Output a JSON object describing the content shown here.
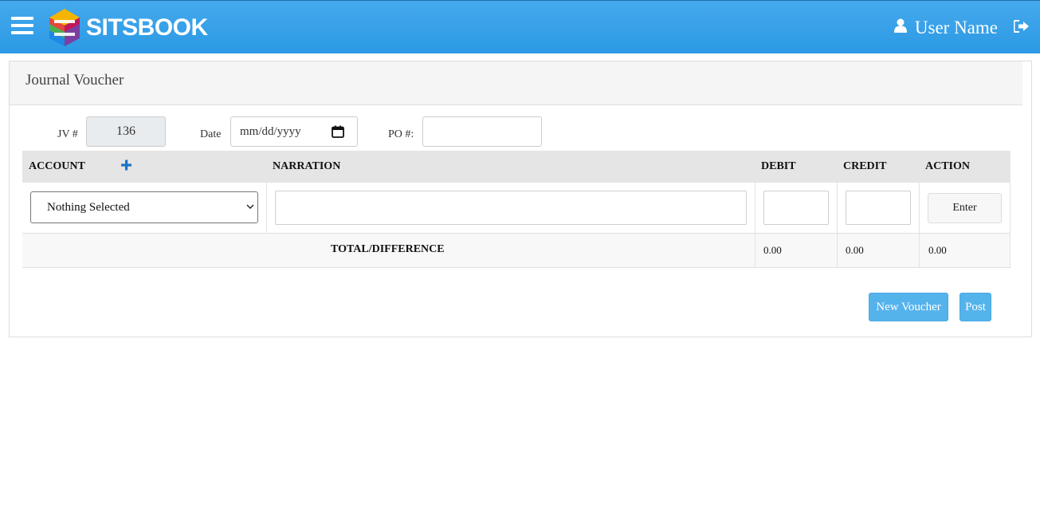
{
  "header": {
    "brand": "SITSBOOK",
    "user_name": "User Name"
  },
  "page": {
    "title": "Journal Voucher"
  },
  "form": {
    "jv_label": "JV #",
    "jv_value": "136",
    "date_label": "Date",
    "date_placeholder": "mm/dd/yyyy",
    "po_label": "PO #:",
    "po_value": ""
  },
  "table": {
    "columns": {
      "account": "ACCOUNT",
      "narration": "NARRATION",
      "debit": "DEBIT",
      "credit": "CREDIT",
      "action": "ACTION"
    },
    "entry_row": {
      "account_selected": "Nothing Selected",
      "narration": "",
      "debit": "",
      "credit": "",
      "enter_label": "Enter"
    },
    "totals": {
      "label": "TOTAL/DIFFERENCE",
      "debit": "0.00",
      "credit": "0.00",
      "difference": "0.00"
    }
  },
  "actions": {
    "new_voucher_label": "New Voucher",
    "post_label": "Post"
  },
  "colors": {
    "navbar": "#2b99e4",
    "button_primary": "#55b3ec",
    "add_icon": "#1a73c8"
  },
  "icons": {
    "menu": "hamburger-icon",
    "logo": "sitsbook-logo-icon",
    "user": "user-icon",
    "logout": "logout-icon",
    "add": "plus-icon",
    "calendar": "calendar-icon",
    "dropdown": "chevron-down-icon"
  }
}
